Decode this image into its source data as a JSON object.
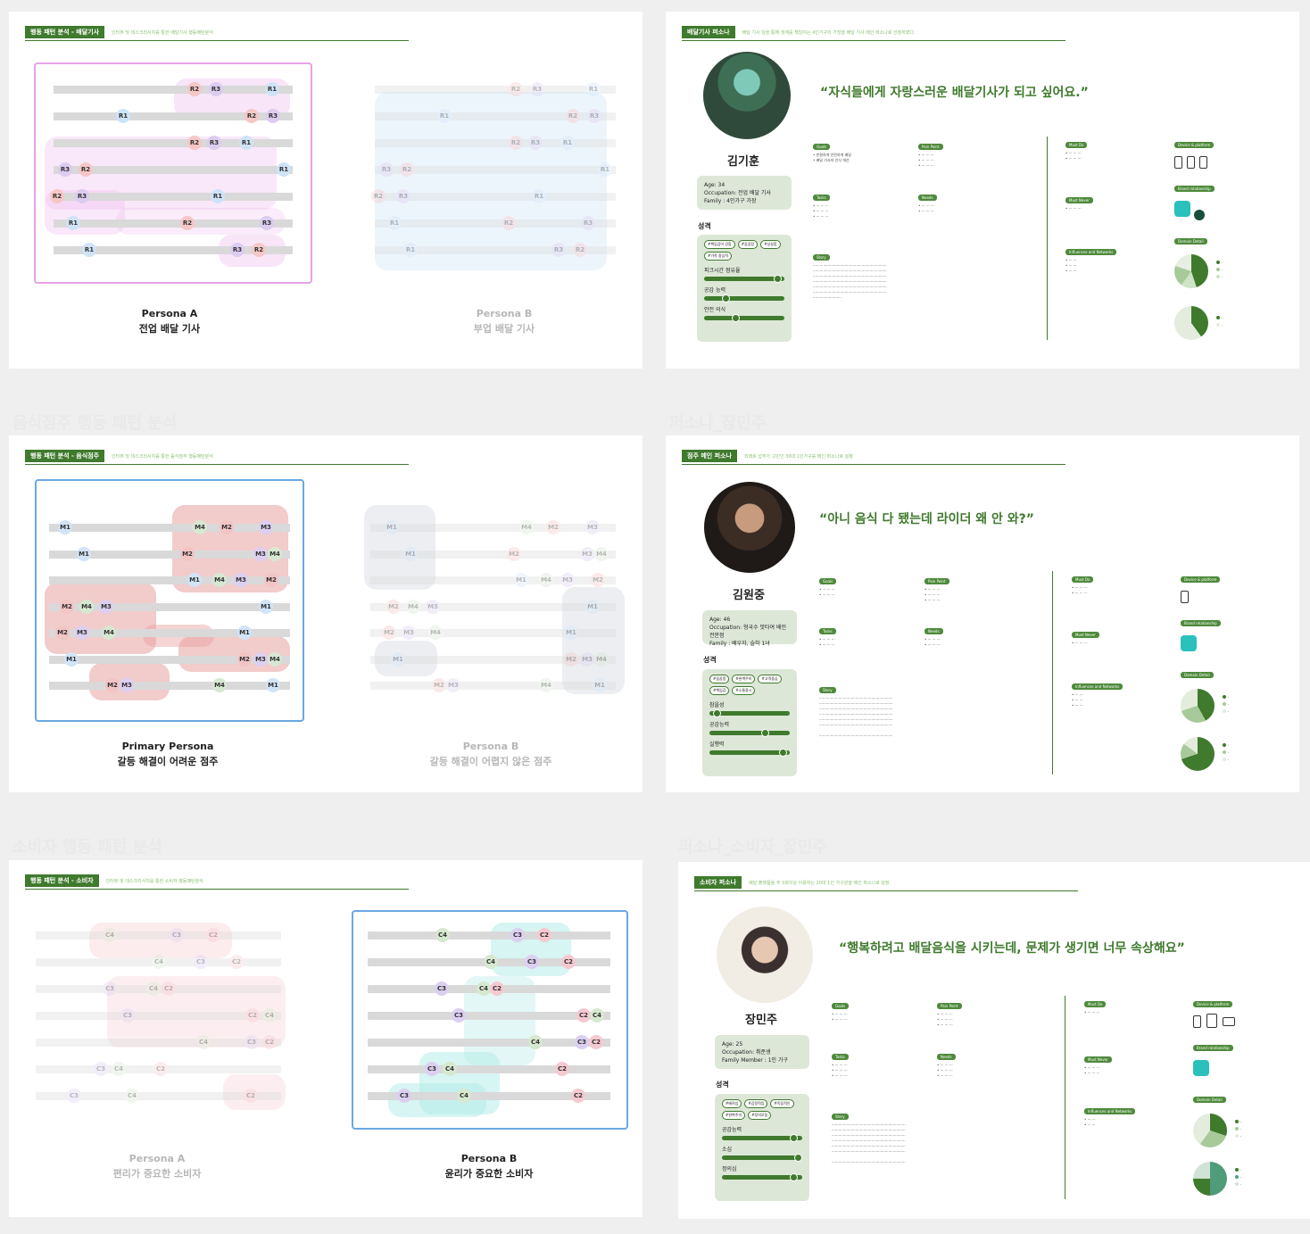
{
  "ghost_titles": [
    "음식점주 행동 패턴 분석",
    "퍼소나_장민주",
    "소비자 행동 패턴 분석",
    "퍼소나_소비자_장민주"
  ],
  "slide1": {
    "tag": "행동 패턴 분석 - 배달기사",
    "sub": "인터뷰 및 데스크리서치를 통한 배달기사 행동패턴분석",
    "personaA_title": "Persona A",
    "personaA_desc": "전업 배달 기사",
    "personaB_title": "Persona B",
    "personaB_desc": "부업 배달 기사",
    "rows": [
      [
        "R2",
        "R3",
        "R1"
      ],
      [
        "R1",
        "R2",
        "R3"
      ],
      [
        "R2",
        "R3",
        "R1"
      ],
      [
        "R3",
        "R2",
        "R1"
      ],
      [
        "R2",
        "R3",
        "R1"
      ],
      [
        "R1",
        "R2",
        "R3"
      ],
      [
        "R1",
        "R3",
        "R2"
      ]
    ]
  },
  "slide2": {
    "tag": "배달기사 퍼소나",
    "sub": "배달 기사 일을 통해 생계를 책임지는 4인가구의 가장을 배달 기사 메인 퍼소나로 선정하였다.",
    "name": "김기훈",
    "age": "Age: 34",
    "occupation": "Occupation: 전업 배달 기사",
    "family": "Family : 4인가구 가장",
    "trait_heading": "성격",
    "chips": [
      "#책임감이 강함",
      "#꼼꼼함",
      "#성실함",
      "#가족 중심적"
    ],
    "traits": [
      {
        "name": "피크시간 점유율",
        "level": 0.92
      },
      {
        "name": "공감 능력",
        "level": 0.28
      },
      {
        "name": "안전 의식",
        "level": 0.4
      }
    ],
    "quote": "“자식들에게 자랑스러운 배달기사가 되고 싶어요.”",
    "tags": [
      "Goals",
      "Pain Point",
      "Tasks",
      "Needs",
      "Story",
      "Must Do",
      "Must Never",
      "Influences and Networks",
      "Device & platform",
      "Brand relationship",
      "Domain Detail"
    ]
  },
  "slide3": {
    "tag": "행동 패턴 분석 - 음식점주",
    "sub": "인터뷰 및 데스크리서치를 통한 음식점주 행동패턴분석",
    "personaA_title": "Primary Persona",
    "personaA_desc": "갈등 해결이 어려운 점주",
    "personaB_title": "Persona B",
    "personaB_desc": "갈등 해결이 어렵지 않은 점주",
    "rows": [
      [
        "M1",
        "M4",
        "M2",
        "M3"
      ],
      [
        "M1",
        "M2",
        "M3",
        "M4"
      ],
      [
        "M1",
        "M4",
        "M3",
        "M2"
      ],
      [
        "M2",
        "M4",
        "M3",
        "M1"
      ],
      [
        "M2",
        "M3",
        "M4",
        "M1"
      ],
      [
        "M1",
        "M2",
        "M3",
        "M4"
      ],
      [
        "M2",
        "M3",
        "M4",
        "M1"
      ]
    ]
  },
  "slide4": {
    "tag": "점주 메인 퍼소나",
    "sub": "외래로 납부가 고민인 30대 1인가구를 메인 퍼소나로 설정",
    "name": "김원중",
    "age": "Age: 46",
    "occupation": "Occupation: 형국수 맛타여 배민 전문점",
    "family": "Family : 배우자, 슬하 1녀",
    "trait_heading": "성격",
    "chips": [
      "#꼼꼼함",
      "#완벽주의",
      "#고객중심",
      "#책임감",
      "#소통중시"
    ],
    "traits": [
      {
        "name": "참을성",
        "level": 0.1
      },
      {
        "name": "공감능력",
        "level": 0.7
      },
      {
        "name": "실행력",
        "level": 0.92
      }
    ],
    "quote": "“아니 음식 다 됐는데 라이더 왜 안 와?”",
    "tags": [
      "Goals",
      "Pain Point",
      "Tasks",
      "Needs",
      "Story",
      "Must Do",
      "Must Never",
      "Influences and Networks",
      "Device & platform",
      "Brand relationship",
      "Domain Detail"
    ]
  },
  "slide5": {
    "tag": "행동 패턴 분석 - 소비자",
    "sub": "인터뷰 및 데스크리서치를 통한 소비자 행동패턴분석",
    "personaA_title": "Persona A",
    "personaA_desc": "편리가 중요한 소비자",
    "personaB_title": "Persona B",
    "personaB_desc": "윤리가 중요한 소비자",
    "rows": [
      [
        "C4",
        "C3",
        "C2"
      ],
      [
        "C4",
        "C3",
        "C2"
      ],
      [
        "C3",
        "C4",
        "C2"
      ],
      [
        "C3",
        "C2",
        "C4"
      ],
      [
        "C4",
        "C3",
        "C2"
      ],
      [
        "C3",
        "C4",
        "C2"
      ],
      [
        "C3",
        "C4",
        "C2"
      ]
    ]
  },
  "slide6": {
    "tag": "소비자 퍼소나",
    "sub": "배달 플랫폼을 주 3회이상 이용하는 20대 1인 가구원을 메인 퍼소나로 설정",
    "name": "장민주",
    "age": "Age: 25",
    "occupation": "Occupation: 취준생",
    "family": "Family Member : 1인 가구",
    "trait_heading": "성격",
    "chips": [
      "#배려심",
      "#감정적임",
      "#독립적인",
      "#완벽주의",
      "#정의로움"
    ],
    "traits": [
      {
        "name": "공감능력",
        "level": 0.9
      },
      {
        "name": "소심",
        "level": 0.95
      },
      {
        "name": "정의심",
        "level": 0.9
      }
    ],
    "quote": "“행복하려고 배달음식을 시키는데, 문제가 생기면 너무 속상해요”",
    "tags": [
      "Goals",
      "Pain Point",
      "Tasks",
      "Needs",
      "Story",
      "Must Do",
      "Must Never",
      "Influences and Networks",
      "Device & platform",
      "Brand relationship",
      "Domain Detail"
    ]
  },
  "colors": {
    "accent": "#3f7a2d",
    "r_frame": "#e6a3e6",
    "m_frame": "#6aa8e0",
    "c_frame": "#6aa8e0"
  }
}
